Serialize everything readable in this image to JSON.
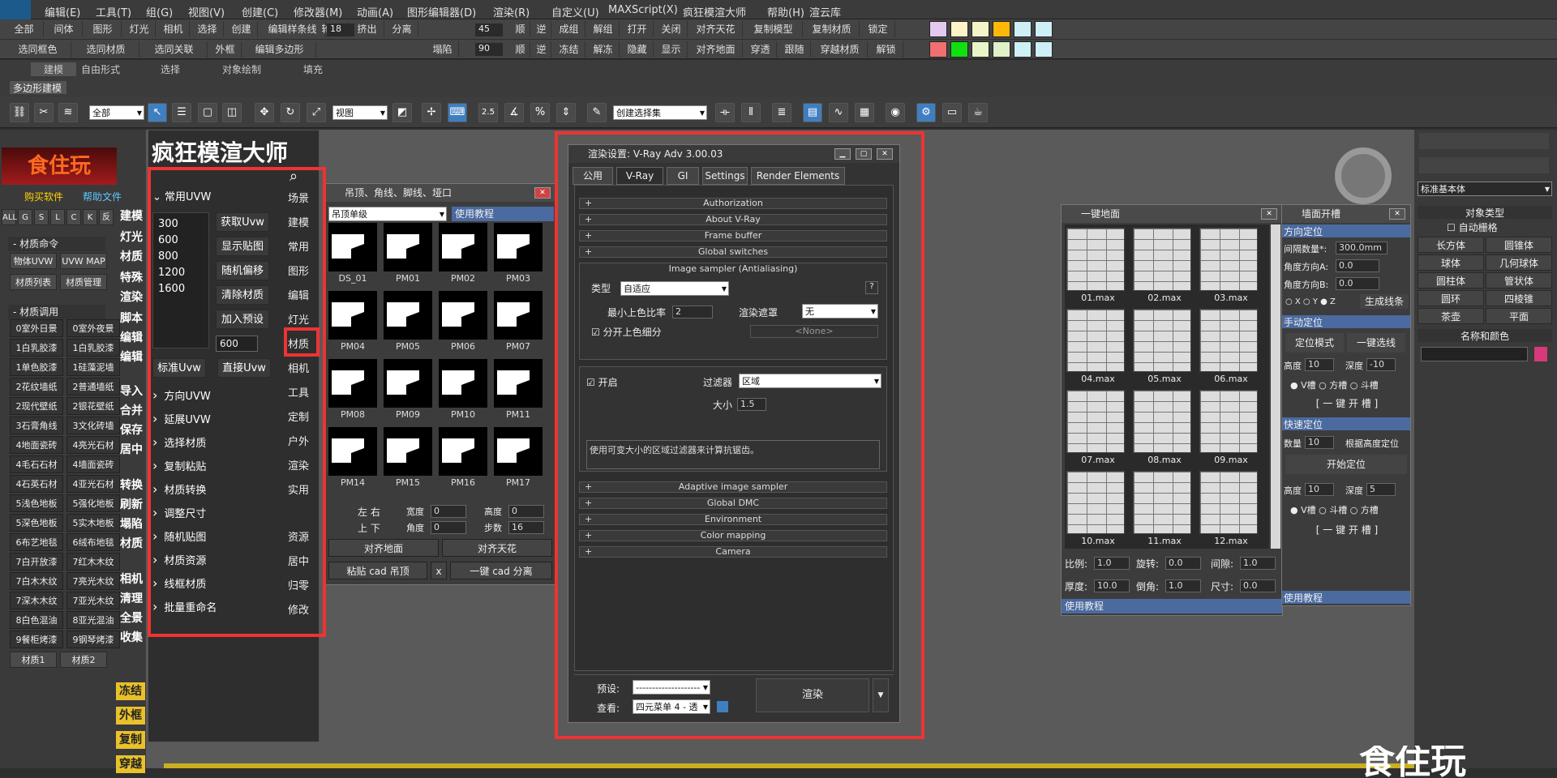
{
  "menu": [
    "编辑(E)",
    "工具(T)",
    "组(G)",
    "视图(V)",
    "创建(C)",
    "修改器(M)",
    "动画(A)",
    "图形编辑器(D)",
    "渲染(R)",
    "自定义(U)",
    "MAXScript(X)",
    "疯狂模渲大师",
    "帮助(H)",
    "渲云库"
  ],
  "quick1": [
    "全部",
    "间体",
    "图形",
    "灯光",
    "相机",
    "选择",
    "创建",
    "编辑样条线",
    "轮廓",
    "挤出",
    "分离",
    "顺",
    "逆",
    "成组",
    "解组",
    "打开",
    "关闭",
    "对齐天花",
    "复制模型",
    "复制材质",
    "锁定"
  ],
  "quick2": [
    "选同框色",
    "选同材质",
    "选同关联",
    "外框",
    "编辑多边形",
    "塌陷",
    "顺",
    "逆",
    "冻结",
    "解冻",
    "隐藏",
    "显示",
    "对齐地面",
    "穿透",
    "跟随",
    "穿越材质",
    "解锁"
  ],
  "quick_nums": {
    "a": "18",
    "b": "45",
    "c": "90"
  },
  "swatches_top": [
    "#e3c8f0",
    "#fff3c8",
    "#f4f4c8",
    "#ffb80a",
    "#cdeff5",
    "#cdeff5"
  ],
  "swatches_bottom": [
    "#f07070",
    "#10e010",
    "#e9f5c8",
    "#e0f0c8",
    "#cdeff5",
    "#cdeff5"
  ],
  "ribbon": {
    "tabs": [
      "建模",
      "自由形式",
      "选择",
      "对象绘制",
      "填充"
    ],
    "sub": "多边形建模"
  },
  "toolbar": {
    "sel_all": "全部",
    "view": "视图",
    "selset": "创建选择集",
    "snap_a": "2.5",
    "snap_b": "%"
  },
  "left": {
    "logo": "食住玩",
    "buy": "购买软件",
    "help": "帮助文件",
    "filters": [
      "ALL",
      "G",
      "S",
      "L",
      "C",
      "K",
      "反"
    ],
    "matcmd": "材质命令",
    "b1": "物体UVW",
    "b2": "UVW MAP",
    "b3": "材质列表",
    "b4": "材质管理",
    "mattitle": "材质调用",
    "mats": [
      "0室外日景",
      "0室外夜景",
      "1白乳胶漆",
      "1白乳胶漆",
      "1单色胶漆",
      "1硅藻泥墙",
      "2花纹墙纸",
      "2普通墙纸",
      "2现代壁纸",
      "2银花壁纸",
      "3石膏角线",
      "3文化砖墙",
      "4地面瓷砖",
      "4亮光石材",
      "4毛石石材",
      "4墙面瓷砖",
      "4石英石材",
      "4亚光石材",
      "5浅色地板",
      "5强化地板",
      "5深色地板",
      "5实木地板",
      "6布艺地毯",
      "6绒布地毯",
      "7白开放漆",
      "7红木木纹",
      "7白木木纹",
      "7亮光木纹",
      "7深木木纹",
      "7亚光木纹",
      "8白色混油",
      "8亚光混油",
      "9餐柜烤漆",
      "9钢琴烤漆"
    ],
    "mat1": "材质1",
    "mat2": "材质2",
    "vcats": [
      "建模",
      "灯光",
      "材质",
      "特殊",
      "渲染",
      "脚本",
      "编辑",
      "编辑",
      "导入",
      "合并",
      "保存",
      "居中",
      "转换",
      "刷新",
      "塌陷",
      "材质",
      "相机",
      "清理",
      "全景",
      "收集"
    ],
    "yellow": [
      "冻结",
      "外框",
      "复制",
      "穿越"
    ]
  },
  "master": {
    "title": "疯狂模渲大师",
    "group": "常用UVW",
    "sizes": [
      "300",
      "600",
      "800",
      "1200",
      "1600"
    ],
    "btns": [
      "获取Uvw",
      "显示贴图",
      "随机偏移",
      "清除材质",
      "加入预设"
    ],
    "spin": "600",
    "std": "标准Uvw",
    "direct": "直接Uvw",
    "folds": [
      "方向UVW",
      "延展UVW",
      "选择材质",
      "复制粘贴",
      "材质转换",
      "调整尺寸",
      "随机贴图",
      "材质资源",
      "线框材质",
      "批量重命名"
    ],
    "cats": [
      "场景",
      "建模",
      "常用",
      "图形",
      "编辑",
      "灯光",
      "材质",
      "相机",
      "工具",
      "定制",
      "户外",
      "渲染",
      "实用",
      "资源",
      "居中",
      "归零",
      "修改"
    ]
  },
  "lib": {
    "title": "吊顶、角线、脚线、垭口",
    "dd": "吊顶单级",
    "tut": "使用教程",
    "thumbs": [
      "DS_01",
      "PM01",
      "PM02",
      "PM03",
      "PM04",
      "PM05",
      "PM06",
      "PM07",
      "PM08",
      "PM09",
      "PM10",
      "PM11",
      "PM14",
      "PM15",
      "PM16",
      "PM17"
    ],
    "lr": "左 右",
    "ud": "上 下",
    "w": "宽度",
    "h": "高度",
    "ang": "角度",
    "step": "步数",
    "wv": "0",
    "hv": "0",
    "av": "0",
    "sv": "16",
    "ground": "对齐地面",
    "ceil": "对齐天花",
    "paste": "粘贴 cad 吊顶",
    "x": "x",
    "split": "一键 cad 分离"
  },
  "render": {
    "title": "渲染设置: V-Ray Adv 3.00.03",
    "tabs": [
      "公用",
      "V-Ray",
      "GI",
      "Settings",
      "Render Elements"
    ],
    "rolls_top": [
      "Authorization",
      "About V-Ray",
      "Frame buffer",
      "Global switches"
    ],
    "sampler": "Image sampler (Antialiasing)",
    "type_l": "类型",
    "type_v": "自适应",
    "minrate": "最小上色比率",
    "minrate_v": "2",
    "mask": "渲染遮罩",
    "mask_v": "无",
    "none": "<None>",
    "split": "分开上色细分",
    "on": "开启",
    "filter_l": "过滤器",
    "filter_v": "区域",
    "size_l": "大小",
    "size_v": "1.5",
    "desc": "使用可变大小的区域过滤器来计算抗锯齿。",
    "rolls_bot": [
      "Adaptive image sampler",
      "Global DMC",
      "Environment",
      "Color mapping",
      "Camera"
    ],
    "preset": "预设:",
    "preset_v": "--------------------",
    "view": "查看:",
    "view_v": "四元菜单 4 - 透",
    "render_btn": "渲染",
    "q": "?"
  },
  "floor": {
    "title": "一键地面",
    "items": [
      "01.max",
      "02.max",
      "03.max",
      "04.max",
      "05.max",
      "06.max",
      "07.max",
      "08.max",
      "09.max",
      "10.max",
      "11.max",
      "12.max"
    ],
    "ratio": "比例:",
    "ratio_v": "1.0",
    "rot": "旋转:",
    "rot_v": "0.0",
    "gap": "间隙:",
    "gap_v": "1.0",
    "thick": "厚度:",
    "thick_v": "10.0",
    "bevel": "倒角:",
    "bevel_v": "1.0",
    "size": "尺寸:",
    "size_v": "0.0",
    "tut": "使用教程"
  },
  "groove": {
    "title": "墙面开槽",
    "s1": "方向定位",
    "spacing": "间隔数量*:",
    "spacing_v": "300.0mm",
    "anga": "角度方向A:",
    "anga_v": "0.0",
    "angb": "角度方向B:",
    "angb_v": "0.0",
    "axes": "○ X  ○ Y  ● Z",
    "gen": "生成线条",
    "s2": "手动定位",
    "mode": "定位模式",
    "pick": "一键选线",
    "ht": "高度",
    "ht_v": "10",
    "dp": "深度",
    "dp_v": "-10",
    "r1": "● V槽  ○ 方槽  ○ 斗槽",
    "open": "[ 一 键 开 槽 ]",
    "s3": "快速定位",
    "cnt": "数量",
    "cnt_v": "10",
    "byh": "根据高度定位",
    "start": "开始定位",
    "ht2_v": "10",
    "dp2_v": "5",
    "r2": "● V槽  ○ 斗槽  ○ 方槽",
    "tut": "使用教程"
  },
  "cmd": {
    "objtype": "对象类型",
    "auto": "自动栅格",
    "std": "标准基本体",
    "items": [
      "长方体",
      "圆锥体",
      "球体",
      "几何球体",
      "圆柱体",
      "管状体",
      "圆环",
      "四棱锥",
      "茶壶",
      "平面"
    ],
    "namecolor": "名称和颜色",
    "accent": "#d63a7a"
  },
  "watermark": "食住玩"
}
